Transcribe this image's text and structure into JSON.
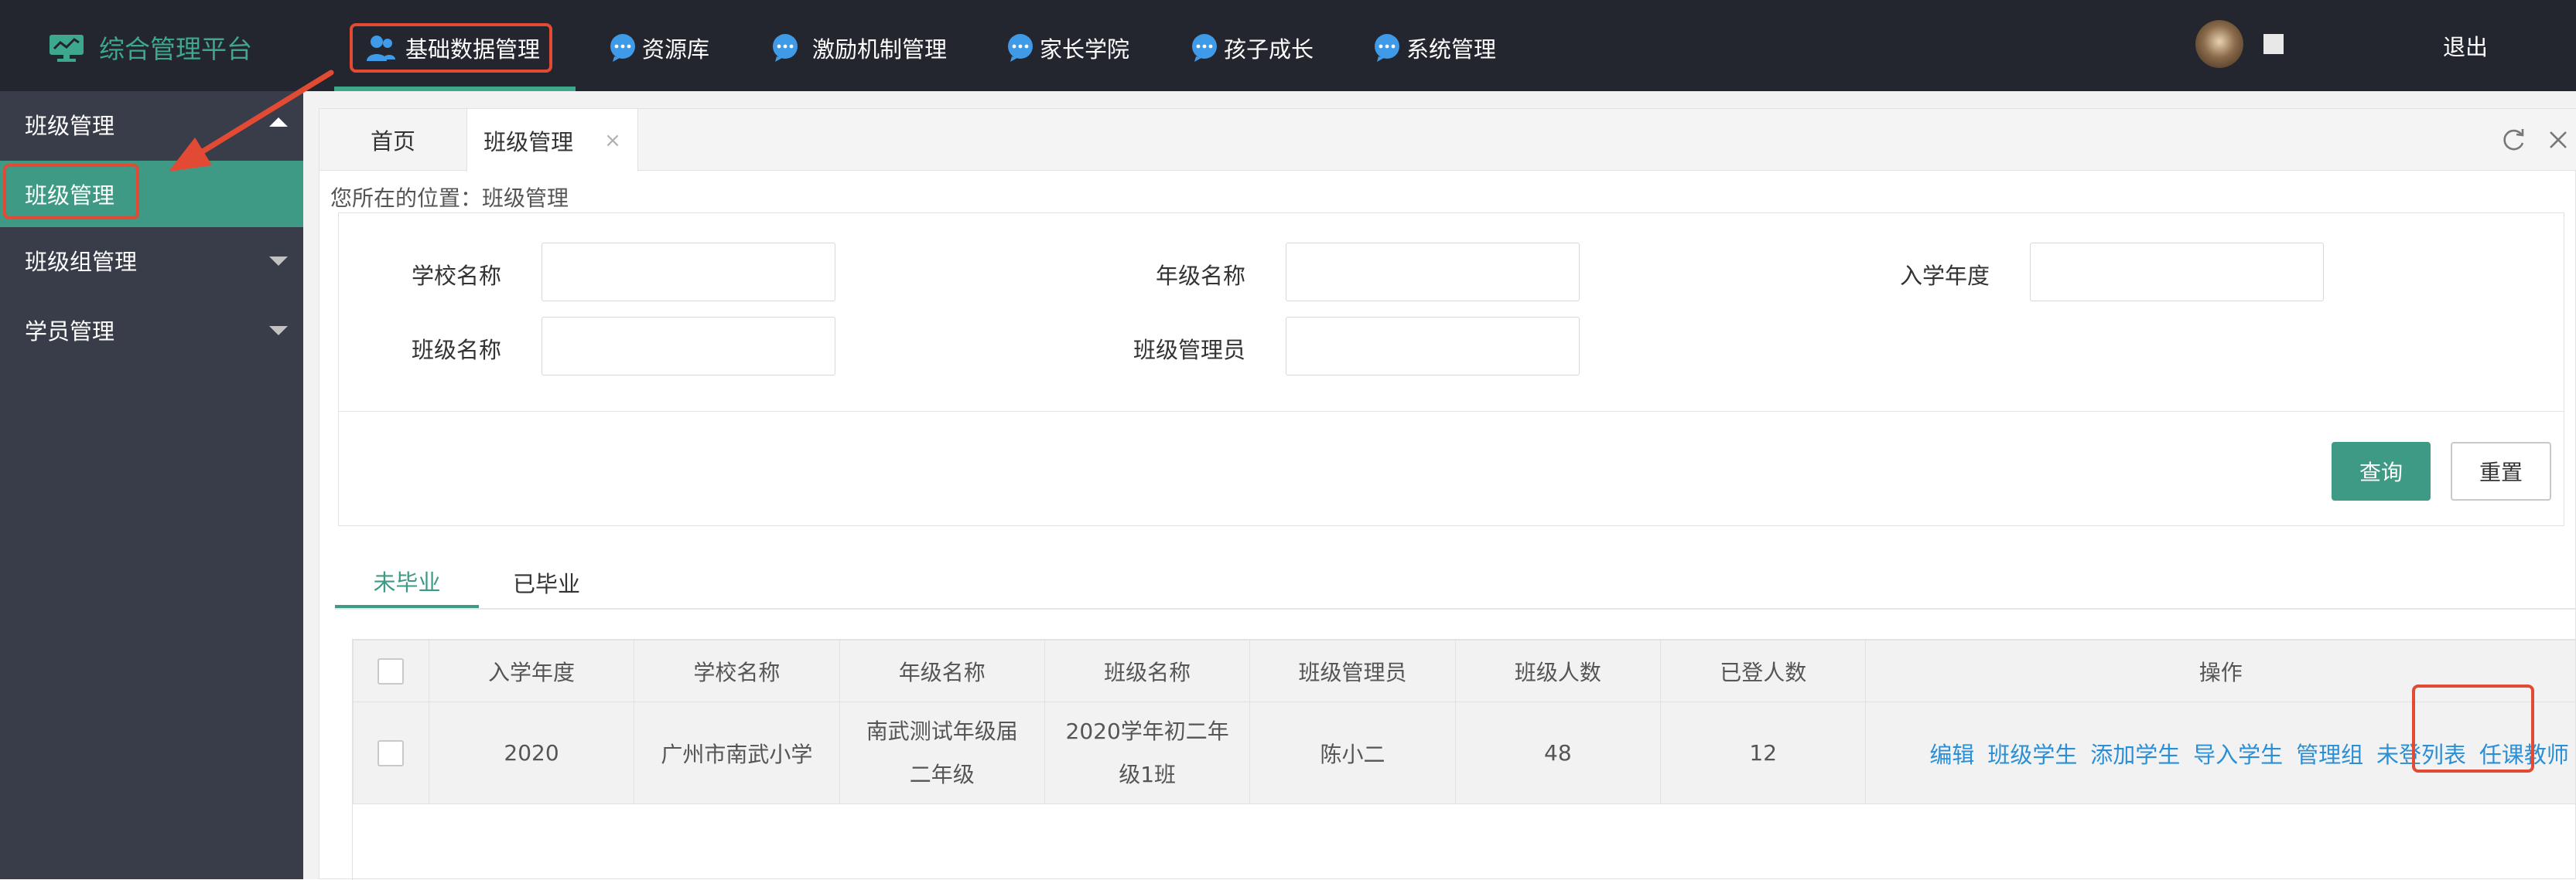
{
  "brand": {
    "title": "综合管理平台",
    "icon": "monitor-icon"
  },
  "nav": {
    "items": [
      {
        "label": "基础数据管理",
        "icon": "users-icon",
        "active": true
      },
      {
        "label": "资源库",
        "icon": "chat-icon"
      },
      {
        "label": "激励机制管理",
        "icon": "chat-icon"
      },
      {
        "label": "家长学院",
        "icon": "chat-icon"
      },
      {
        "label": "孩子成长",
        "icon": "chat-icon"
      },
      {
        "label": "系统管理",
        "icon": "chat-icon"
      }
    ],
    "logout": "退出"
  },
  "sidebar": {
    "items": [
      {
        "label": "班级管理",
        "expanded": true
      },
      {
        "label": "班级管理",
        "active": true
      },
      {
        "label": "班级组管理"
      },
      {
        "label": "学员管理"
      }
    ]
  },
  "tabs": {
    "home": "首页",
    "current": "班级管理",
    "close": "×"
  },
  "breadcrumb": "您所在的位置：班级管理",
  "search": {
    "school_label": "学校名称",
    "grade_label": "年级名称",
    "year_label": "入学年度",
    "class_label": "班级名称",
    "manager_label": "班级管理员",
    "school_value": "",
    "grade_value": "",
    "year_value": "",
    "class_value": "",
    "manager_value": "",
    "query_button": "查询",
    "reset_button": "重置"
  },
  "status_tabs": {
    "active": "未毕业",
    "graduated": "已毕业"
  },
  "table": {
    "headers": [
      "入学年度",
      "学校名称",
      "年级名称",
      "班级名称",
      "班级管理员",
      "班级人数",
      "已登人数",
      "操作"
    ],
    "rows": [
      {
        "year": "2020",
        "school": "广州市南武小学",
        "grade_line1": "南武测试年级届",
        "grade_line2": "二年级",
        "class_line1": "2020学年初二年",
        "class_line2": "级1班",
        "manager": "陈小二",
        "size": "48",
        "logged": "12",
        "ops": [
          "编辑",
          "班级学生",
          "添加学生",
          "导入学生",
          "管理组",
          "未登列表",
          "任课教师"
        ]
      }
    ]
  },
  "colors": {
    "accent": "#3e9a84",
    "topbar": "#23262e",
    "sidebar": "#393d49",
    "link": "#2b8fd6",
    "highlight": "#e24a34"
  }
}
